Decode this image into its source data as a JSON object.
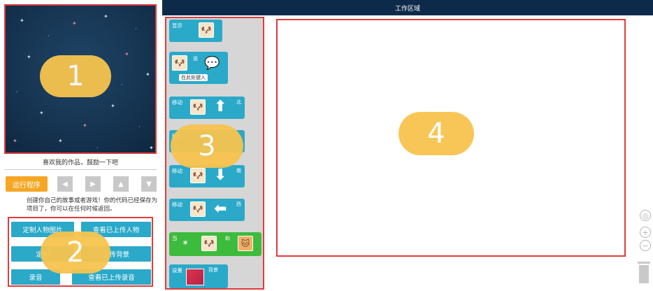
{
  "topbar": {
    "title": "工作区域"
  },
  "stage": {
    "caption": "喜欢我的作品，鼓励一下吧"
  },
  "controls": {
    "run_label": "运行程序",
    "buttons": [
      {
        "icon": "left-arrow-icon",
        "glyph": "◀"
      },
      {
        "icon": "right-arrow-icon",
        "glyph": "▶"
      },
      {
        "icon": "up-arrow-icon",
        "glyph": "▲"
      },
      {
        "icon": "down-arrow-icon",
        "glyph": "▼"
      }
    ]
  },
  "description": "创建你自己的故事或者游戏！你的代码已经保存为项目了，你可以在任何时候返回。",
  "actions": {
    "custom_character": "定制人物图片",
    "view_uploaded_characters": "查看已上传人物",
    "custom_background": "定制",
    "view_uploaded_backgrounds": "上传背景",
    "record": "录音",
    "view_uploaded_recordings": "查看已上传录音"
  },
  "blocks": {
    "show": "显示",
    "say": "说",
    "say_input": "在此处键入",
    "move1": "移动",
    "dir_north": "北",
    "move2": "移动",
    "move3": "移动",
    "dir_south": "南",
    "move4": "移动",
    "dir_west": "西",
    "when": "当",
    "and": "和",
    "set": "设置",
    "background": "背景"
  },
  "badges": {
    "b1": "1",
    "b2": "2",
    "b3": "3",
    "b4": "4"
  },
  "colors": {
    "accent_orange": "#f5a623",
    "block_blue": "#2aa9c9",
    "block_green": "#3dbb3d",
    "highlight_red": "#e23b3b",
    "badge_yellow": "#f7c44e",
    "topbar_navy": "#0e2a4a"
  }
}
